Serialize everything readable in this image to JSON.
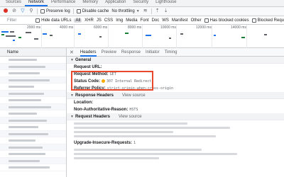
{
  "tabs": [
    "Sources",
    "Network",
    "Performance",
    "Memory",
    "Application",
    "Security",
    "Lighthouse"
  ],
  "toolbar": {
    "preserve_log": "Preserve log",
    "disable_cache": "Disable cache",
    "throttling": "No throttling",
    "icons": [
      "record-icon",
      "clear-icon",
      "filter-icon",
      "search-icon",
      "wifi-icon",
      "upload-icon",
      "download-icon"
    ]
  },
  "filterbar": {
    "filter_placeholder": "Filter",
    "hide_data_urls": "Hide data URLs",
    "types": [
      "All",
      "XHR",
      "JS",
      "CSS",
      "Img",
      "Media",
      "Font",
      "Doc",
      "WS",
      "Manifest",
      "Other"
    ],
    "has_blocked_cookies": "Has blocked cookies",
    "blocked_requests": "Blocked Requ"
  },
  "timeline": {
    "ticks": [
      "2000 ms",
      "4000 ms",
      "6000 ms",
      "8000 ms",
      "10000 ms",
      "12000 ms",
      "14000 ms"
    ]
  },
  "requests": {
    "name_header": "Name"
  },
  "details": {
    "tabs": [
      "Headers",
      "Preview",
      "Response",
      "Initiator",
      "Timing"
    ],
    "general": {
      "title": "General",
      "request_url_key": "Request URL:",
      "request_method_key": "Request Method:",
      "request_method_val": "GET",
      "status_code_key": "Status Code:",
      "status_code_val": "307 Internal Redirect",
      "referrer_policy_key": "Referrer Policy:",
      "referrer_policy_val": "strict-origin-when-cross-origin"
    },
    "response_headers": {
      "title": "Response Headers",
      "view_source": "View source",
      "location_key": "Location:",
      "non_auth_key": "Non-Authoritative-Reason:",
      "non_auth_val": "HSTS"
    },
    "request_headers": {
      "title": "Request Headers",
      "view_source": "View source",
      "upgrade_key": "Upgrade-Insecure-Requests:",
      "upgrade_val": "1"
    }
  },
  "colors": {
    "accent": "#1a73e8",
    "record": "#d93025",
    "highlight_box": "#e8482c",
    "status_warning": "#f9ab00"
  }
}
